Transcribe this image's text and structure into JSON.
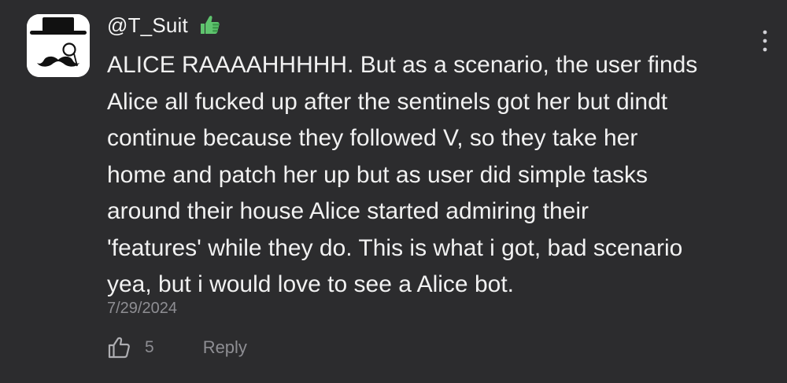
{
  "comment": {
    "username": "@T_Suit",
    "badge_icon": "thumbs-up-badge-icon",
    "badge_color": "#5fc46e",
    "avatar_icon": "top-hat-monocle-mustache-icon",
    "body": "ALICE RAAAAHHHHH. But as a scenario, the user finds\nAlice all fucked up after the sentinels got her but dindt\ncontinue because they followed V, so they take her\nhome and patch her up but as user did simple tasks\naround their house Alice started admiring their\n'features' while they do. This is what i got, bad scenario\nyea, but i would love to see a Alice bot.",
    "timestamp": "7/29/2024",
    "like_count": "5",
    "reply_label": "Reply",
    "more_icon": "more-vertical-icon"
  },
  "colors": {
    "background": "#2c2c2e",
    "text_primary": "#f1f1f1",
    "text_secondary": "#8e8e93"
  }
}
